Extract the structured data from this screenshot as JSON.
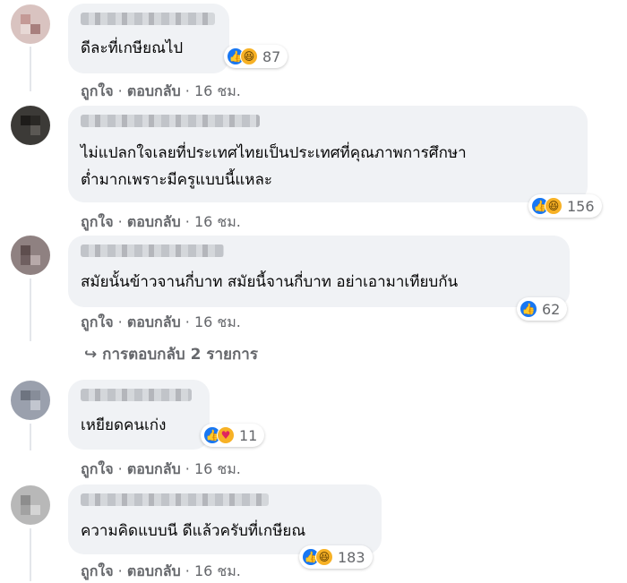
{
  "actions": {
    "like": "ถูกใจ",
    "reply": "ตอบกลับ",
    "sep": "·"
  },
  "comments": [
    {
      "text": [
        "ดีละที่เกษียณไป"
      ],
      "reactions": [
        "like-icon",
        "haha-icon"
      ],
      "count": "87",
      "time": "16 ชม."
    },
    {
      "text": [
        "ไม่แปลกใจเลยที่ประเทศไทยเป็นประเทศที่คุณภาพการศึกษา",
        "ต่ำมากเพราะมีครูแบบนี้แหละ"
      ],
      "reactions": [
        "like-icon",
        "haha-icon"
      ],
      "count": "156",
      "time": "16 ชม."
    },
    {
      "text": [
        "สมัยนั้นข้าวจานกี่บาท สมัยนี้จานกี่บาท อย่าเอามาเทียบกัน"
      ],
      "reactions": [
        "like-icon"
      ],
      "count": "62",
      "time": "16 ชม."
    },
    {
      "text": [
        "เหยียดคนเก่ง"
      ],
      "reactions": [
        "like-icon",
        "care-icon"
      ],
      "count": "11",
      "time": "16 ชม."
    },
    {
      "text": [
        "ความคิดแบบนี ดีแล้วครับที่เกษียณ"
      ],
      "reactions": [
        "like-icon",
        "haha-icon"
      ],
      "count": "183",
      "time": "16 ชม."
    }
  ],
  "replies_link": "↪ การตอบกลับ 2 รายการ",
  "colors": {
    "like": "#1877f2",
    "haha": "#f7b125",
    "bubble": "#f0f2f5",
    "meta": "#65676b"
  }
}
